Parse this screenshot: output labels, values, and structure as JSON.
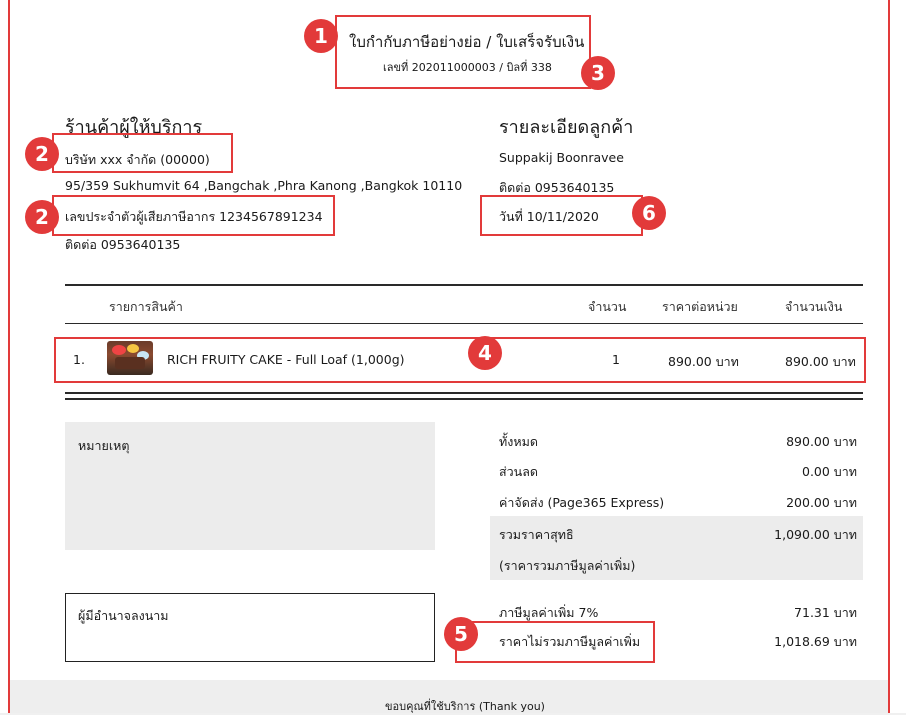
{
  "header": {
    "title": "ใบกำกับภาษีอย่างย่อ / ใบเสร็จรับเงิน",
    "doc_number": "เลขที่ 202011000003 / บิลที่ 338"
  },
  "provider": {
    "heading": "ร้านค้าผู้ให้บริการ",
    "company": "บริษัท xxx จำกัด (00000)",
    "address": "95/359 Sukhumvit 64 ,Bangchak ,Phra Kanong ,Bangkok 10110",
    "tax_id": "เลขประจำตัวผู้เสียภาษีอากร 1234567891234",
    "contact": "ติดต่อ 0953640135"
  },
  "customer": {
    "heading": "รายละเอียดลูกค้า",
    "name": "Suppakij Boonravee",
    "contact": "ติดต่อ 0953640135",
    "date": "วันที่  10/11/2020"
  },
  "table": {
    "headers": {
      "item": "รายการสินค้า",
      "qty": "จำนวน",
      "unit_price": "ราคาต่อหน่วย",
      "amount": "จำนวนเงิน"
    },
    "rows": [
      {
        "no": "1.",
        "name": "RICH FRUITY CAKE - Full Loaf (1,000g)",
        "qty": "1",
        "unit_price": "890.00 บาท",
        "amount": "890.00 บาท"
      }
    ]
  },
  "note": {
    "label": "หมายเหตุ"
  },
  "signature": {
    "label": "ผู้มีอำนาจลงนาม"
  },
  "summary": {
    "total_label": "ทั้งหมด",
    "total_value": "890.00 บาท",
    "discount_label": "ส่วนลด",
    "discount_value": "0.00 บาท",
    "shipping_label": "ค่าจัดส่ง   (Page365 Express)",
    "shipping_value": "200.00 บาท",
    "net_label": "รวมราคาสุทธิ",
    "net_value": "1,090.00 บาท",
    "net_note": "(ราคารวมภาษีมูลค่าเพิ่ม)",
    "vat_label": "ภาษีมูลค่าเพิ่ม 7%",
    "vat_value": "71.31 บาท",
    "exvat_label": "ราคาไม่รวมภาษีมูลค่าเพิ่ม",
    "exvat_value": "1,018.69 บาท"
  },
  "footer": {
    "thanks": "ขอบคุณที่ใช้บริการ (Thank you)"
  },
  "badges": [
    "1",
    "2",
    "2",
    "3",
    "4",
    "5",
    "6"
  ],
  "colors": {
    "annotation_red": "#e23a3a",
    "summary_gray": "#ececec"
  }
}
